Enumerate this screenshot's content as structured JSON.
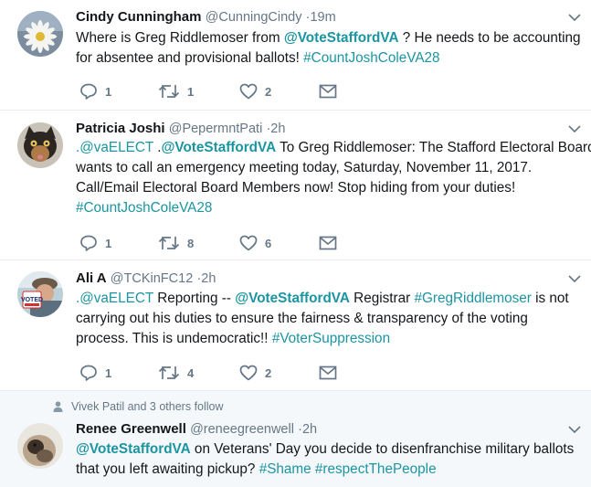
{
  "tweets": [
    {
      "fullname": "Cindy Cunningham",
      "handle": "@CunningCindy",
      "time": "·19m",
      "lines": [
        [
          {
            "t": "Where is Greg Riddlemoser from ",
            "k": "text"
          },
          {
            "t": "@VoteStaffordVA",
            "k": "mention"
          },
          {
            "t": " ? He needs to be accounting",
            "k": "text"
          }
        ],
        [
          {
            "t": "for absentee and provisional ballots! ",
            "k": "text"
          },
          {
            "t": "#CountJoshColeVA28",
            "k": "hashtag"
          }
        ]
      ],
      "replies": "1",
      "retweets": "1",
      "likes": "2"
    },
    {
      "fullname": "Patricia Joshi",
      "handle": "@PepermntPati",
      "time": "·2h",
      "lines": [
        [
          {
            "t": ".@vaELECT",
            "k": "link"
          },
          {
            "t": " .",
            "k": "text"
          },
          {
            "t": "@VoteStaffordVA",
            "k": "mention"
          },
          {
            "t": " To Greg Riddlemoser: The Stafford Electoral Board",
            "k": "text"
          }
        ],
        [
          {
            "t": "wants to call an emergency meeting today, Saturday, November 11, 2017.",
            "k": "text"
          }
        ],
        [
          {
            "t": "Call/Email Electoral Board Members now! Stop hiding from your duties!",
            "k": "text"
          }
        ],
        [
          {
            "t": "#CountJoshColeVA28",
            "k": "hashtag"
          }
        ]
      ],
      "replies": "1",
      "retweets": "8",
      "likes": "6"
    },
    {
      "fullname": "Ali A",
      "handle": "@TCKinFC12",
      "time": "·2h",
      "lines": [
        [
          {
            "t": ".@vaELECT",
            "k": "link"
          },
          {
            "t": " Reporting -- ",
            "k": "text"
          },
          {
            "t": "@VoteStaffordVA",
            "k": "mention"
          },
          {
            "t": " Registrar ",
            "k": "text"
          },
          {
            "t": "#GregRiddlemoser",
            "k": "hashtag"
          },
          {
            "t": " is not",
            "k": "text"
          }
        ],
        [
          {
            "t": "carrying out his duties to ensure the fairness & transparency of the voting",
            "k": "text"
          }
        ],
        [
          {
            "t": "process. This is undemocratic!! ",
            "k": "text"
          },
          {
            "t": "#VoterSuppression",
            "k": "hashtag"
          }
        ]
      ],
      "replies": "1",
      "retweets": "4",
      "likes": "2"
    },
    {
      "context": "Vivek Patil and 3 others follow",
      "fullname": "Renee Greenwell",
      "handle": "@reneegreenwell",
      "time": "·2h",
      "lines": [
        [
          {
            "t": "@VoteStaffordVA",
            "k": "mention"
          },
          {
            "t": " on Veterans' Day you decide to disenfranchise military ballots",
            "k": "text"
          }
        ],
        [
          {
            "t": "that you left awaiting pickup? ",
            "k": "text"
          },
          {
            "t": "#Shame",
            "k": "hashtag"
          },
          {
            "t": " ",
            "k": "text"
          },
          {
            "t": "#respectThePeople",
            "k": "hashtag"
          }
        ]
      ]
    }
  ],
  "icons": {
    "reply": "reply-icon",
    "retweet": "retweet-icon",
    "like": "heart-icon",
    "message": "envelope-icon",
    "caret": "chevron-down-icon",
    "person": "person-icon"
  },
  "colors": {
    "link": "#1b95a1",
    "muted": "#657786",
    "divider": "#e6ecf0"
  }
}
